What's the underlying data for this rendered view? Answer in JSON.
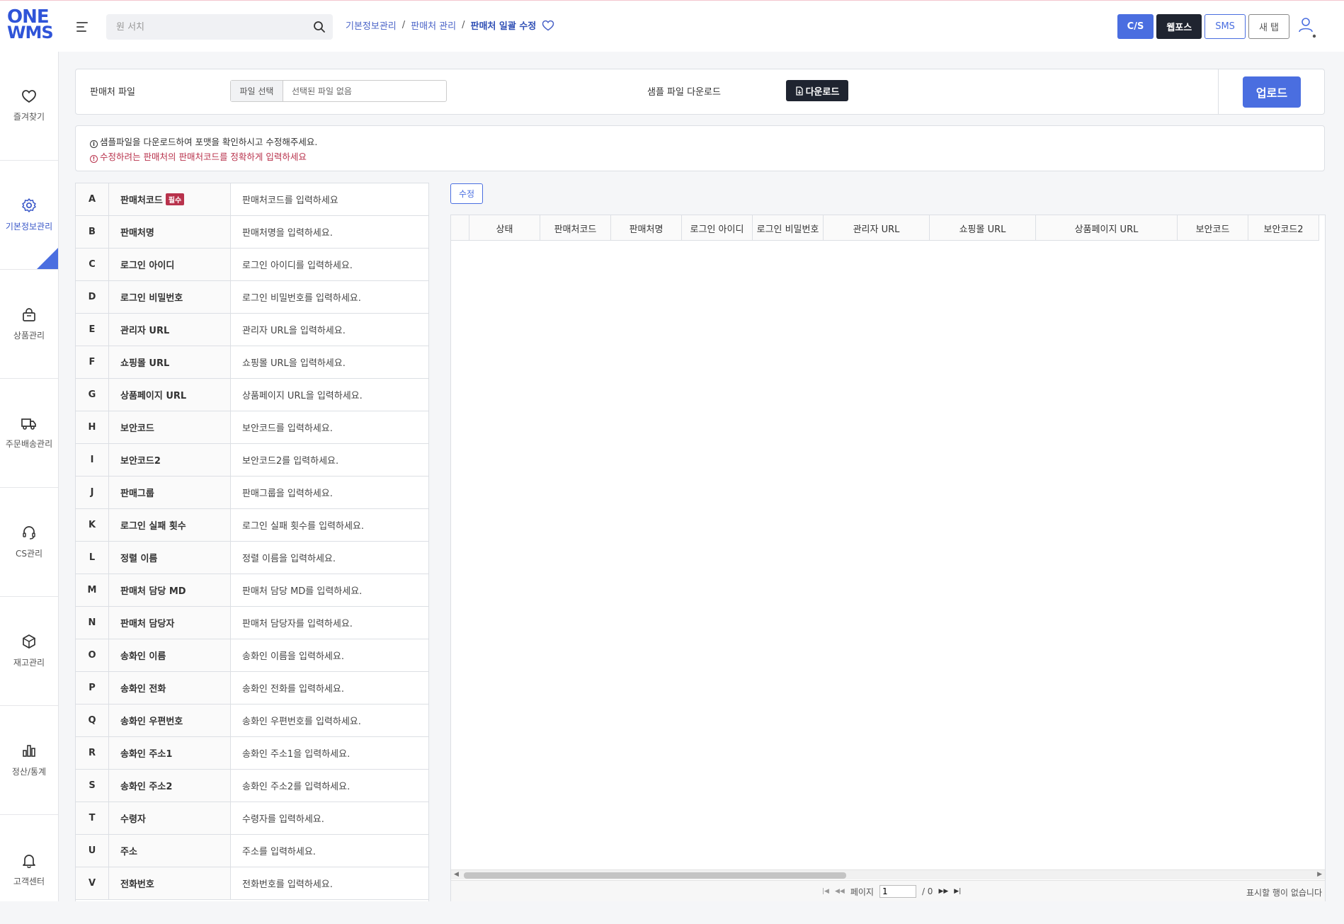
{
  "logo": {
    "line1": "ONE",
    "line2": "WMS"
  },
  "search": {
    "placeholder": "원 서치"
  },
  "breadcrumb": {
    "items": [
      "기본정보관리",
      "판매처 관리"
    ],
    "current": "판매처 일괄 수정"
  },
  "top_buttons": {
    "cs": "C/S",
    "webpos": "웹포스",
    "sms": "SMS",
    "new_tab": "새 탭"
  },
  "sidebar": {
    "items": [
      {
        "label": "즐겨찾기",
        "icon": "heart-icon"
      },
      {
        "label": "기본정보관리",
        "icon": "gear-icon"
      },
      {
        "label": "상품관리",
        "icon": "bag-icon"
      },
      {
        "label": "주문배송관리",
        "icon": "truck-icon"
      },
      {
        "label": "CS관리",
        "icon": "headset-icon"
      },
      {
        "label": "재고관리",
        "icon": "box-icon"
      },
      {
        "label": "정산/통계",
        "icon": "bar-chart-icon"
      },
      {
        "label": "고객센터",
        "icon": "bell-icon"
      }
    ]
  },
  "file_panel": {
    "label": "판매처 파일",
    "choose_label": "파일 선택",
    "no_file": "선택된 파일 없음",
    "sample_label": "샘플 파일 다운로드",
    "download_label": "다운로드",
    "upload_label": "업로드"
  },
  "notice": {
    "line1": "샘플파일을 다운로드하여 포맷을 확인하시고 수정해주세요.",
    "line2": "수정하려는 판매처의 판매처코드를 정확하게 입력하세요"
  },
  "fields": {
    "required_badge": "필수",
    "rows": [
      {
        "col": "A",
        "name": "판매처코드",
        "desc": "판매처코드를 입력하세요"
      },
      {
        "col": "B",
        "name": "판매처명",
        "desc": "판매처명을 입력하세요."
      },
      {
        "col": "C",
        "name": "로그인 아이디",
        "desc": "로그인 아이디를 입력하세요."
      },
      {
        "col": "D",
        "name": "로그인 비밀번호",
        "desc": "로그인 비밀번호를 입력하세요."
      },
      {
        "col": "E",
        "name": "관리자 URL",
        "desc": "관리자 URL을 입력하세요."
      },
      {
        "col": "F",
        "name": "쇼핑몰 URL",
        "desc": "쇼핑몰 URL을 입력하세요."
      },
      {
        "col": "G",
        "name": "상품페이지 URL",
        "desc": "상품페이지 URL을 입력하세요."
      },
      {
        "col": "H",
        "name": "보안코드",
        "desc": "보안코드를 입력하세요."
      },
      {
        "col": "I",
        "name": "보안코드2",
        "desc": "보안코드2를 입력하세요."
      },
      {
        "col": "J",
        "name": "판매그룹",
        "desc": "판매그룹을 입력하세요."
      },
      {
        "col": "K",
        "name": "로그인 실패 횟수",
        "desc": "로그인 실패 횟수를 입력하세요."
      },
      {
        "col": "L",
        "name": "정렬 이름",
        "desc": "정렬 이름을 입력하세요."
      },
      {
        "col": "M",
        "name": "판매처 담당 MD",
        "desc": "판매처 담당 MD를 입력하세요."
      },
      {
        "col": "N",
        "name": "판매처 담당자",
        "desc": "판매처 담당자를 입력하세요."
      },
      {
        "col": "O",
        "name": "송화인 이름",
        "desc": "송화인 이름을 입력하세요."
      },
      {
        "col": "P",
        "name": "송화인 전화",
        "desc": "송화인 전화를 입력하세요."
      },
      {
        "col": "Q",
        "name": "송화인 우편번호",
        "desc": "송화인 우편번호를 입력하세요."
      },
      {
        "col": "R",
        "name": "송화인 주소1",
        "desc": "송화인 주소1을 입력하세요."
      },
      {
        "col": "S",
        "name": "송화인 주소2",
        "desc": "송화인 주소2를 입력하세요."
      },
      {
        "col": "T",
        "name": "수령자",
        "desc": "수령자를 입력하세요."
      },
      {
        "col": "U",
        "name": "주소",
        "desc": "주소를 입력하세요."
      },
      {
        "col": "V",
        "name": "전화번호",
        "desc": "전화번호를 입력하세요."
      }
    ]
  },
  "grid": {
    "edit_label": "수정",
    "columns": [
      "",
      "상태",
      "판매처코드",
      "판매처명",
      "로그인 아이디",
      "로그인 비밀번호",
      "관리자 URL",
      "쇼핑몰 URL",
      "상품페이지 URL",
      "보안코드",
      "보안코드2"
    ],
    "pager": {
      "page_label": "페이지",
      "page_value": "1",
      "total": "/ 0",
      "empty_text": "표시할 행이 없습니다"
    }
  },
  "colors": {
    "primary": "#4a6ee0",
    "dark": "#1f2430",
    "danger": "#b8324c"
  }
}
